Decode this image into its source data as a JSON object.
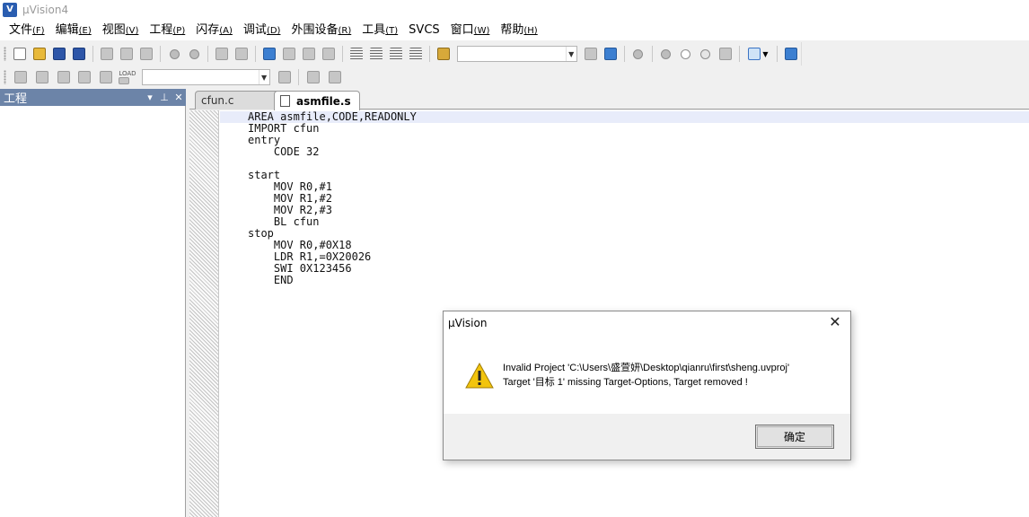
{
  "window": {
    "title": "µVision4",
    "app_icon_letter": "V"
  },
  "menu": [
    {
      "label": "文件",
      "key": "(F)"
    },
    {
      "label": "编辑",
      "key": "(E)"
    },
    {
      "label": "视图",
      "key": "(V)"
    },
    {
      "label": "工程",
      "key": "(P)"
    },
    {
      "label": "闪存",
      "key": "(A)"
    },
    {
      "label": "调试",
      "key": "(D)"
    },
    {
      "label": "外围设备",
      "key": "(R)"
    },
    {
      "label": "工具",
      "key": "(T)"
    },
    {
      "label": "SVCS",
      "key": ""
    },
    {
      "label": "窗口",
      "key": "(W)"
    },
    {
      "label": "帮助",
      "key": "(H)"
    }
  ],
  "toolbar2": {
    "load_label": "LOAD"
  },
  "project_pane": {
    "title": "工程",
    "dropdown_glyph": "▾",
    "pin_glyph": "⊥",
    "close_glyph": "✕"
  },
  "tabs": [
    {
      "label": "cfun.c",
      "active": false
    },
    {
      "label": "asmfile.s",
      "active": true
    }
  ],
  "code_lines": [
    "AREA asmfile,CODE,READONLY",
    "IMPORT cfun",
    "entry",
    "    CODE 32",
    "",
    "start",
    "    MOV R0,#1",
    "    MOV R1,#2",
    "    MOV R2,#3",
    "    BL cfun",
    "stop",
    "    MOV R0,#0X18",
    "    LDR R1,=0X20026",
    "    SWI 0X123456",
    "    END"
  ],
  "dialog": {
    "title": "µVision",
    "close_glyph": "✕",
    "message_line1": "Invalid Project 'C:\\Users\\盛萱妍\\Desktop\\qianru\\first\\sheng.uvproj'",
    "message_line2": "Target '目标 1' missing Target-Options, Target removed !",
    "ok_label": "确定",
    "icon": "warning-icon"
  }
}
